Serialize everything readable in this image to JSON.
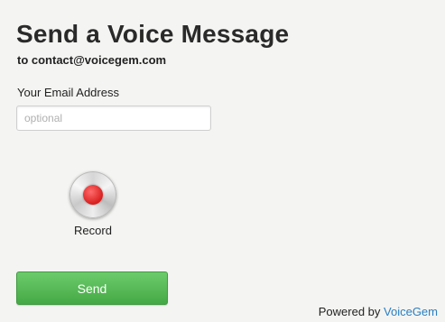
{
  "header": {
    "title": "Send a Voice Message",
    "recipient": "to contact@voicegem.com"
  },
  "form": {
    "email_label": "Your Email Address",
    "email_value": "",
    "email_placeholder": "optional"
  },
  "recorder": {
    "label": "Record",
    "icon": "record-icon",
    "dot_color": "#e02424"
  },
  "actions": {
    "send_label": "Send",
    "send_color": "#4caf50"
  },
  "footer": {
    "powered_prefix": "Powered by",
    "brand_link": "VoiceGem",
    "brand_color": "#2a7fc1"
  }
}
